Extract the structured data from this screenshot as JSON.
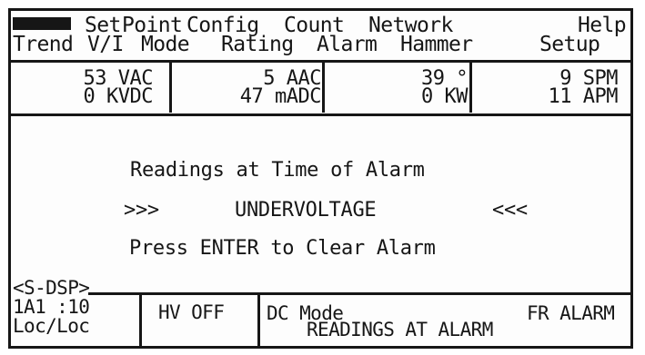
{
  "menu": {
    "row1": [
      {
        "label": "",
        "highlighted": true
      },
      {
        "label": "Set"
      },
      {
        "label": "Point"
      },
      {
        "label": "Config"
      },
      {
        "label": "Count"
      },
      {
        "label": "Network"
      },
      {
        "label": "Help"
      }
    ],
    "row2": [
      {
        "label": "Trend"
      },
      {
        "label": "V/I"
      },
      {
        "label": "Mode"
      },
      {
        "label": "Rating"
      },
      {
        "label": "Alarm"
      },
      {
        "label": "Hammer"
      },
      {
        "label": "Setup"
      }
    ]
  },
  "meters": {
    "voltage": {
      "line1": "53 VAC",
      "line2": "0 KVDC"
    },
    "current": {
      "line1": "5 AAC",
      "line2": "47 mADC"
    },
    "temp_power": {
      "line1": "39 °",
      "line2": "0 KW"
    },
    "rate": {
      "line1": "9 SPM",
      "line2": "11 APM"
    }
  },
  "alarm": {
    "heading": "Readings at Time of Alarm",
    "left_marker": ">>>",
    "condition": "UNDERVOLTAGE",
    "right_marker": "<<<",
    "instruction": "Press ENTER to Clear Alarm"
  },
  "status": {
    "display_tag": "<S-DSP>",
    "unit_address": "1A1 :10",
    "control": "Loc/Loc",
    "hv_state": "HV OFF",
    "mode": "DC Mode",
    "readings_label": "READINGS AT ALARM",
    "alarm_state": "FR ALARM"
  }
}
